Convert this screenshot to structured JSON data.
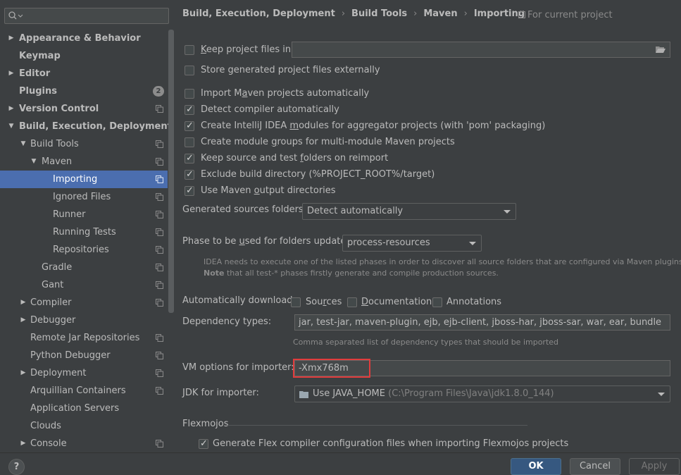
{
  "search": {
    "placeholder": ""
  },
  "sidebar": {
    "items": [
      {
        "label": "Appearance & Behavior",
        "level": 0,
        "arrow": "right",
        "bold": true,
        "project": false
      },
      {
        "label": "Keymap",
        "level": 0,
        "arrow": "none",
        "bold": true,
        "project": false
      },
      {
        "label": "Editor",
        "level": 0,
        "arrow": "right",
        "bold": true,
        "project": false
      },
      {
        "label": "Plugins",
        "level": 0,
        "arrow": "none",
        "bold": true,
        "project": false,
        "badge": "2"
      },
      {
        "label": "Version Control",
        "level": 0,
        "arrow": "right",
        "bold": true,
        "project": true
      },
      {
        "label": "Build, Execution, Deployment",
        "level": 0,
        "arrow": "down",
        "bold": true,
        "project": false
      },
      {
        "label": "Build Tools",
        "level": 1,
        "arrow": "down",
        "bold": false,
        "project": true
      },
      {
        "label": "Maven",
        "level": 2,
        "arrow": "down",
        "bold": false,
        "project": true
      },
      {
        "label": "Importing",
        "level": 3,
        "arrow": "none",
        "bold": false,
        "project": true,
        "selected": true
      },
      {
        "label": "Ignored Files",
        "level": 3,
        "arrow": "none",
        "bold": false,
        "project": true
      },
      {
        "label": "Runner",
        "level": 3,
        "arrow": "none",
        "bold": false,
        "project": true
      },
      {
        "label": "Running Tests",
        "level": 3,
        "arrow": "none",
        "bold": false,
        "project": true
      },
      {
        "label": "Repositories",
        "level": 3,
        "arrow": "none",
        "bold": false,
        "project": true
      },
      {
        "label": "Gradle",
        "level": 2,
        "arrow": "none",
        "bold": false,
        "project": true
      },
      {
        "label": "Gant",
        "level": 2,
        "arrow": "none",
        "bold": false,
        "project": true
      },
      {
        "label": "Compiler",
        "level": 1,
        "arrow": "right",
        "bold": false,
        "project": true
      },
      {
        "label": "Debugger",
        "level": 1,
        "arrow": "right",
        "bold": false,
        "project": false
      },
      {
        "label": "Remote Jar Repositories",
        "level": 1,
        "arrow": "none",
        "bold": false,
        "project": true
      },
      {
        "label": "Python Debugger",
        "level": 1,
        "arrow": "none",
        "bold": false,
        "project": true
      },
      {
        "label": "Deployment",
        "level": 1,
        "arrow": "right",
        "bold": false,
        "project": true
      },
      {
        "label": "Arquillian Containers",
        "level": 1,
        "arrow": "none",
        "bold": false,
        "project": true
      },
      {
        "label": "Application Servers",
        "level": 1,
        "arrow": "none",
        "bold": false,
        "project": false
      },
      {
        "label": "Clouds",
        "level": 1,
        "arrow": "none",
        "bold": false,
        "project": false
      },
      {
        "label": "Console",
        "level": 1,
        "arrow": "right",
        "bold": false,
        "project": true
      }
    ]
  },
  "breadcrumb": [
    "Build, Execution, Deployment",
    "Build Tools",
    "Maven",
    "Importing"
  ],
  "current_project_label": "For current project",
  "settings": {
    "keep_project_files": {
      "pre": "",
      "u": "K",
      "post": "eep project files in:",
      "checked": false
    },
    "keep_project_files_path": "",
    "store_externally": {
      "label": "Store generated project files externally",
      "checked": false
    },
    "import_auto": {
      "pre": "Import M",
      "u": "a",
      "post": "ven projects automatically",
      "checked": false
    },
    "detect_compiler": {
      "label": "Detect compiler automatically",
      "checked": true
    },
    "create_modules_aggregator": {
      "pre": "Create IntelliJ IDEA ",
      "u": "m",
      "post": "odules for aggregator projects (with 'pom' packaging)",
      "checked": true
    },
    "create_module_groups": {
      "pre": "Create module ",
      "u": "g",
      "post": "roups for multi-module Maven projects",
      "checked": false
    },
    "keep_source_folders": {
      "pre": "Keep source and test ",
      "u": "f",
      "post": "olders on reimport",
      "checked": true
    },
    "exclude_build_dir": {
      "label": "Exclude build directory (%PROJECT_ROOT%/target)",
      "checked": true
    },
    "use_maven_output": {
      "pre": "Use Maven ",
      "u": "o",
      "post": "utput directories",
      "checked": true
    },
    "generated_sources_label": "Generated sources folders:",
    "generated_sources_value": "Detect automatically",
    "phase_label_pre": "Phase to be ",
    "phase_label_u": "u",
    "phase_label_post": "sed for folders update:",
    "phase_value": "process-resources",
    "phase_hint_line1": "IDEA needs to execute one of the listed phases in order to discover all source folders that are configured via Maven plugins.",
    "phase_hint_note": "Note",
    "phase_hint_line2": " that all test-* phases firstly generate and compile production sources.",
    "auto_download_label": "Automatically download:",
    "dl_sources": {
      "pre": "Sou",
      "u": "r",
      "post": "ces",
      "checked": false
    },
    "dl_documentation": {
      "pre": "",
      "u": "D",
      "post": "ocumentation",
      "checked": false
    },
    "dl_annotations": {
      "label": "Annotations",
      "checked": false
    },
    "dependency_types_label": "Dependency types:",
    "dependency_types_value": "jar, test-jar, maven-plugin, ejb, ejb-client, jboss-har, jboss-sar, war, ear, bundle",
    "dependency_types_hint": "Comma separated list of dependency types that should be imported",
    "vm_options_label": "VM options for importer:",
    "vm_options_value": "-Xmx768m",
    "jdk_label": "JDK for importer:",
    "jdk_value": "Use JAVA_HOME",
    "jdk_path": "(C:\\Program Files\\Java\\jdk1.8.0_144)",
    "flexmojos_title": "Flexmojos",
    "flex_generate": {
      "label": "Generate Flex compiler configuration files when importing Flexmojos projects",
      "checked": true
    }
  },
  "buttons": {
    "help": "?",
    "ok": "OK",
    "cancel": "Cancel",
    "apply": "Apply"
  },
  "colors": {
    "background": "#3c3f41",
    "selection": "#4b6eaf",
    "highlight_box": "#e03c3c",
    "primary_button": "#365880"
  }
}
